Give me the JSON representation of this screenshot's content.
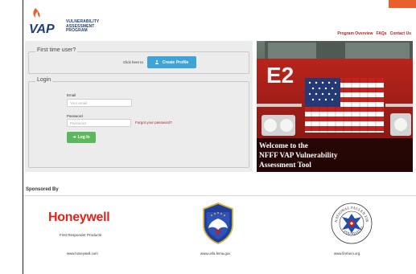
{
  "brand": {
    "abbr": "VAP",
    "line1": "VULNERABILITY",
    "line2": "ASSESSMENT",
    "line3": "PROGRAM",
    "accent_color": "#e8602c",
    "navy": "#1f3f7a"
  },
  "nav": {
    "items": [
      {
        "label": "Program Overview"
      },
      {
        "label": "FAQs"
      },
      {
        "label": "Contact Us"
      }
    ]
  },
  "first_time": {
    "legend": "First time user?",
    "prompt": "Click here to",
    "create_label": "Create Profile",
    "button_color": "#3ea3d6"
  },
  "login": {
    "legend": "Login",
    "email_label": "Email",
    "email_placeholder": "Your email",
    "password_label": "Password",
    "password_placeholder": "Password",
    "forgot_label": "Forgot your password?",
    "login_label": "Log In",
    "button_color": "#5cb85c"
  },
  "hero": {
    "title_line1": "Welcome to the",
    "title_line2": "NFFF VAP Vulnerability",
    "title_line3": "Assessment Tool",
    "truck_number": "E2"
  },
  "sponsors": {
    "heading": "Sponsored By",
    "items": [
      {
        "name": "Honeywell",
        "subtitle": "First Responder Products",
        "url": "www.honeywell.com"
      },
      {
        "name": "USFA",
        "url": "www.usfa.fema.gov"
      },
      {
        "name": "National Fallen Firefighters Foundation",
        "seal_top": "NATIONAL FALLEN FIREFIGHTERS",
        "seal_bottom": "FOUNDATION",
        "url": "www.firehero.org"
      }
    ]
  }
}
